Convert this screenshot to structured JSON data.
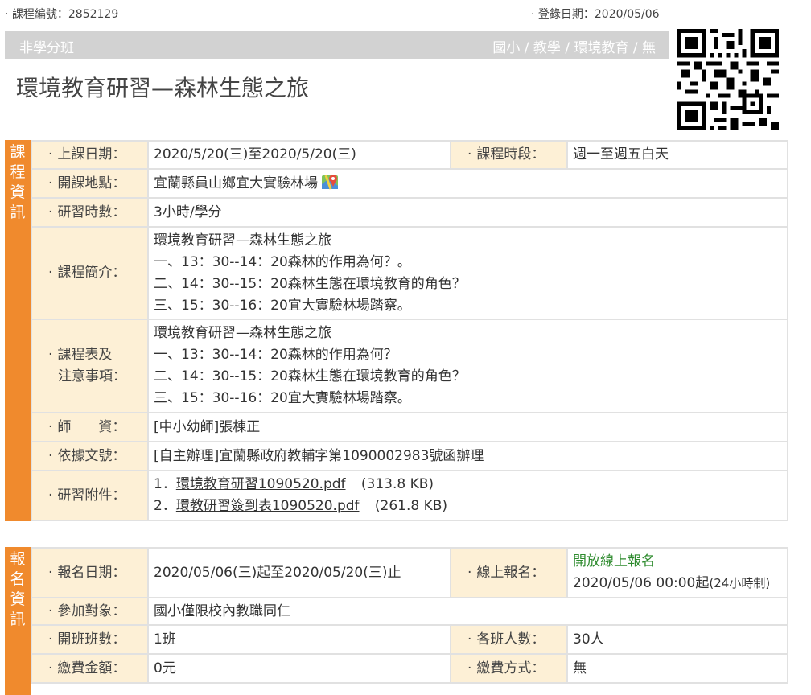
{
  "header": {
    "course_no": "· 課程編號：2852129",
    "reg_date": "· 登錄日期：2020/05/06",
    "bar_left": "非學分班",
    "bar_right": "國小 / 教學 / 環境教育 / 無",
    "title": "環境教育研習—森林生態之旅"
  },
  "course_info": {
    "side_label": [
      "課",
      "程",
      "資",
      "訊"
    ],
    "date_label": "上課日期：",
    "date_value": "2020/5/20(三)至2020/5/20(三)",
    "period_label": "課程時段：",
    "period_value": "週一至週五白天",
    "location_label": "開課地點：",
    "location_value": "宜蘭縣員山鄉宜大實驗林場",
    "hours_label": "研習時數：",
    "hours_value": "3小時/學分",
    "intro_label": "課程簡介：",
    "intro_lines": [
      "環境教育研習—森林生態之旅",
      "一、13：30--14：20森林的作用為何？。",
      "二、14：30--15：20森林生態在環境教育的角色？",
      "三、15：30--16：20宜大實驗林場踏察。"
    ],
    "schedule_label_1": "課程表及",
    "schedule_label_2": "注意事項：",
    "schedule_lines": [
      "環境教育研習—森林生態之旅",
      "一、13：30--14：20森林的作用為何？",
      "二、14：30--15：20森林生態在環境教育的角色？",
      "三、15：30--16：20宜大實驗林場踏察。"
    ],
    "teacher_label": "師　　資：",
    "teacher_value": "[中小幼師]張棟正",
    "basis_label": "依據文號：",
    "basis_value": "[自主辦理]宜蘭縣政府教輔字第1090002983號函辦理",
    "attach_label": "研習附件：",
    "attachments": [
      {
        "num": "1．",
        "name": "環境教育研習1090520.pdf",
        "size": "(313.8 KB)"
      },
      {
        "num": "2．",
        "name": "環教研習簽到表1090520.pdf",
        "size": "(261.8 KB)"
      }
    ]
  },
  "signup_info": {
    "side_label": [
      "報",
      "名",
      "資",
      "訊"
    ],
    "signup_date_label": "報名日期：",
    "signup_date_value": "2020/05/06(三)起至2020/05/20(三)止",
    "online_label": "線上報名：",
    "online_status": "開放線上報名",
    "online_start": "2020/05/06 00:00起",
    "online_note": "(24小時制)",
    "target_label": "參加對象：",
    "target_value": "國小僅限校內教職同仁",
    "classes_label": "開班班數：",
    "classes_value": "1班",
    "per_class_label": "各班人數：",
    "per_class_value": "30人",
    "fee_label": "繳費金額：",
    "fee_value": "0元",
    "pay_label": "繳費方式：",
    "pay_value": "無"
  },
  "colors": {
    "accent": "#f08a2d",
    "label_bg": "#fdf0d6",
    "bar_bg": "#d2d2d2",
    "status_green": "#2e8b2e"
  },
  "icons": [
    "map-icon",
    "qr-code"
  ]
}
